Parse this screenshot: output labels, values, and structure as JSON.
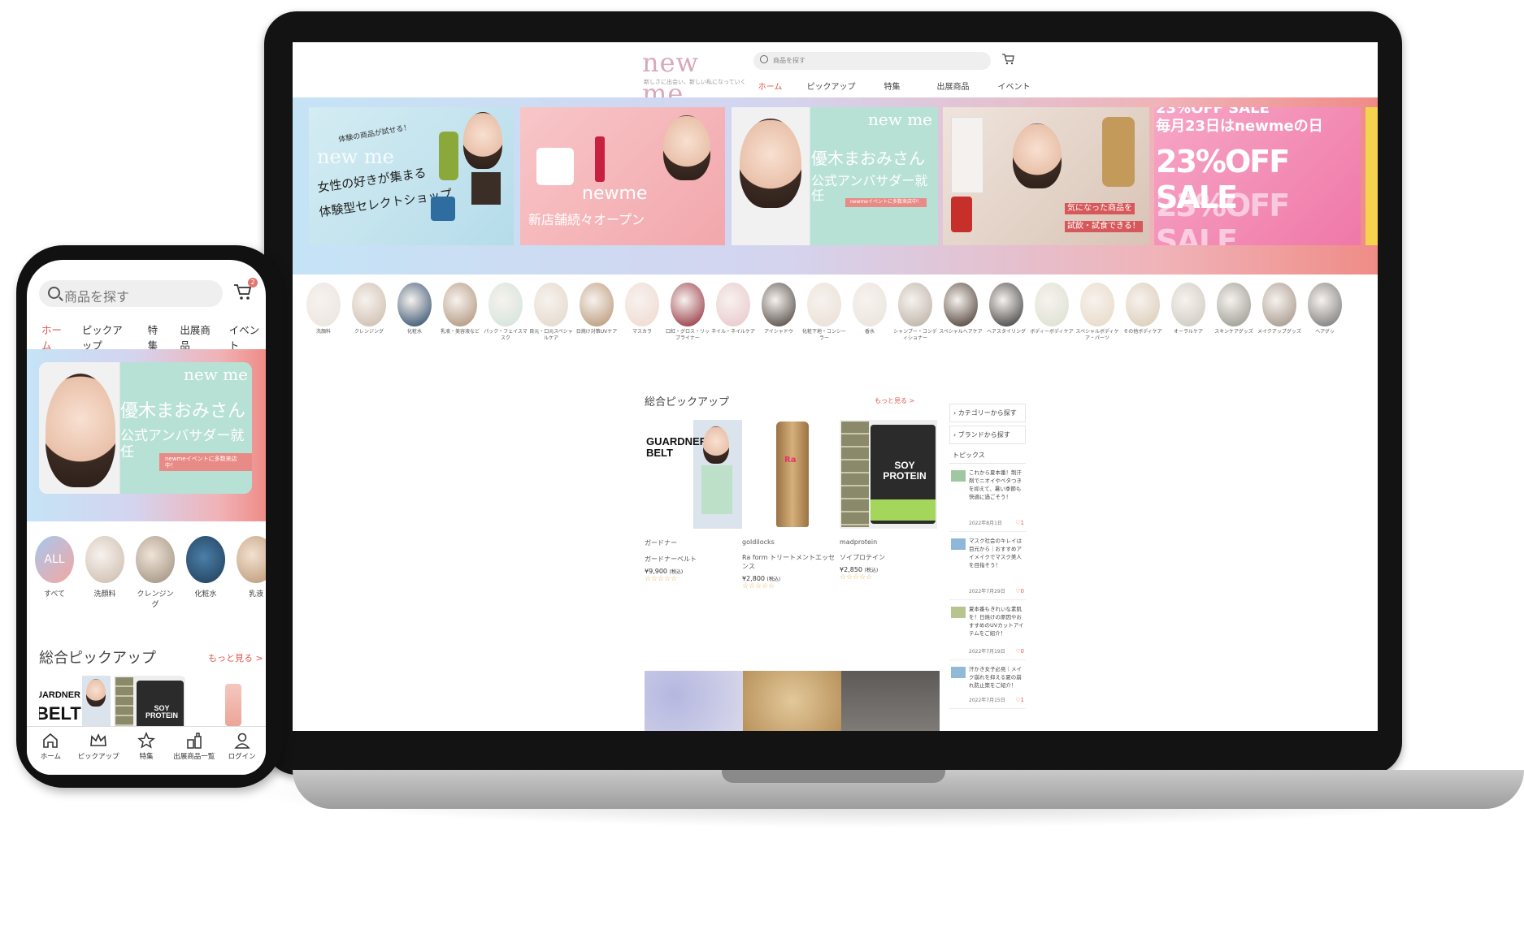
{
  "laptop": {
    "logo": "new me",
    "tagline": "新しさに出会い、新しい私になっていく",
    "search_placeholder": "商品を探す",
    "nav": [
      "ホーム",
      "ピックアップ",
      "特集",
      "出展商品",
      "イベント"
    ],
    "banners": {
      "b1_line1": "体験の商品が試せる！",
      "b1_logo": "new me",
      "b1_line2": "女性の好きが集まる",
      "b1_line3": "体験型セレクトショップ",
      "b2_brand": "newme",
      "b2_line": "新店舗続々オープン",
      "b3_logo": "new me",
      "b3_line1": "優木まおみさん",
      "b3_line2": "公式アンバサダー就任",
      "b3_pill": "newmeイベントに多数来店中！",
      "b4_line1": "気になった商品を",
      "b4_line2": "試飲・試食できる！",
      "b5_line1": "23%OFF SALE",
      "b5_line2": "毎月23日はnewmeの日",
      "b5_line3": "23%OFF SALE",
      "b5_line4": "23%OFF SALE"
    },
    "categories": [
      "洗顔料",
      "クレンジング",
      "化粧水",
      "乳液・美容液など",
      "パック・フェイスマスク",
      "目元・口元スペシャルケア",
      "日焼け対策UVケア",
      "マスカラ",
      "口紅・グロス・リップライナー",
      "ネイル・ネイルケア",
      "アイシャドウ",
      "化粧下地・コンシーラー",
      "香水",
      "シャンプー・コンディショナー",
      "スペシャルヘアケア",
      "ヘアスタイリング",
      "ボディーボディケア",
      "スペシャルボディケア・パーツ",
      "その他ボディケア",
      "オーラルケア",
      "スキンケアグッズ",
      "メイクアップグッズ",
      "ヘアグッ"
    ],
    "pickup_title": "総合ピックアップ",
    "pickup_more": "もっと見る >",
    "products": [
      {
        "brand": "ガードナー",
        "name": "ガードナーベルト",
        "price": "¥9,900",
        "tax": "(税込)",
        "stars": "☆☆☆☆☆",
        "img_text": "GUARDNER BELT"
      },
      {
        "brand": "goldilocks",
        "name": "Ra form トリートメントエッセンス",
        "price": "¥2,800",
        "tax": "(税込)",
        "stars": "☆☆☆☆☆",
        "img_text": "Ra"
      },
      {
        "brand": "madprotein",
        "name": "ソイプロテイン",
        "price": "¥2,850",
        "tax": "(税込)",
        "stars": "☆☆☆☆☆",
        "img_text": "SOY PROTEIN"
      }
    ],
    "sidebar": {
      "category_link": "カテゴリーから探す",
      "brand_link": "ブランドから探す",
      "topics_title": "トピックス",
      "topics": [
        {
          "title": "これから夏本番！制汗剤でニオイやベタつきを抑えて、暑い季節も快適に過ごそう！",
          "date": "2022年8月1日",
          "likes": "1"
        },
        {
          "title": "マスク社会のキレイは目元から｜おすすめアイメイクでマスク美人を目指そう！",
          "date": "2022年7月29日",
          "likes": "0"
        },
        {
          "title": "夏本番もきれいな素肌を！日焼けの原因やおすすめのUVカットアイテムをご紹介！",
          "date": "2022年7月19日",
          "likes": "0"
        },
        {
          "title": "汗かき女子必見｜メイク崩れを抑える夏の崩れ防止策をご紹介！",
          "date": "2022年7月15日",
          "likes": "1"
        }
      ]
    }
  },
  "phone": {
    "search_placeholder": "商品を探す",
    "cart_count": "2",
    "tabs": [
      "ホーム",
      "ピックアップ",
      "特集",
      "出展商品",
      "イベント"
    ],
    "banner": {
      "logo": "new me",
      "line1": "優木まおみさん",
      "line2": "公式アンバサダー就任",
      "pill": "newmeイベントに多数来店中！"
    },
    "categories": [
      {
        "label": "すべて",
        "badge": "ALL"
      },
      {
        "label": "洗顔料"
      },
      {
        "label": "クレンジング"
      },
      {
        "label": "化粧水"
      },
      {
        "label": "乳液"
      }
    ],
    "pickup_title": "総合ピックアップ",
    "pickup_more": "もっと見る >",
    "product_texts": {
      "guardner": "UARDNER",
      "belt": "BELT",
      "soy": "SOY PROTEIN"
    },
    "bottom_nav": [
      "ホーム",
      "ピックアップ",
      "特集",
      "出展商品一覧",
      "ログイン"
    ]
  },
  "colors": {
    "accent": "#e05a4f",
    "gradient_start": "#c5e3f6",
    "gradient_end": "#ef8c87"
  }
}
